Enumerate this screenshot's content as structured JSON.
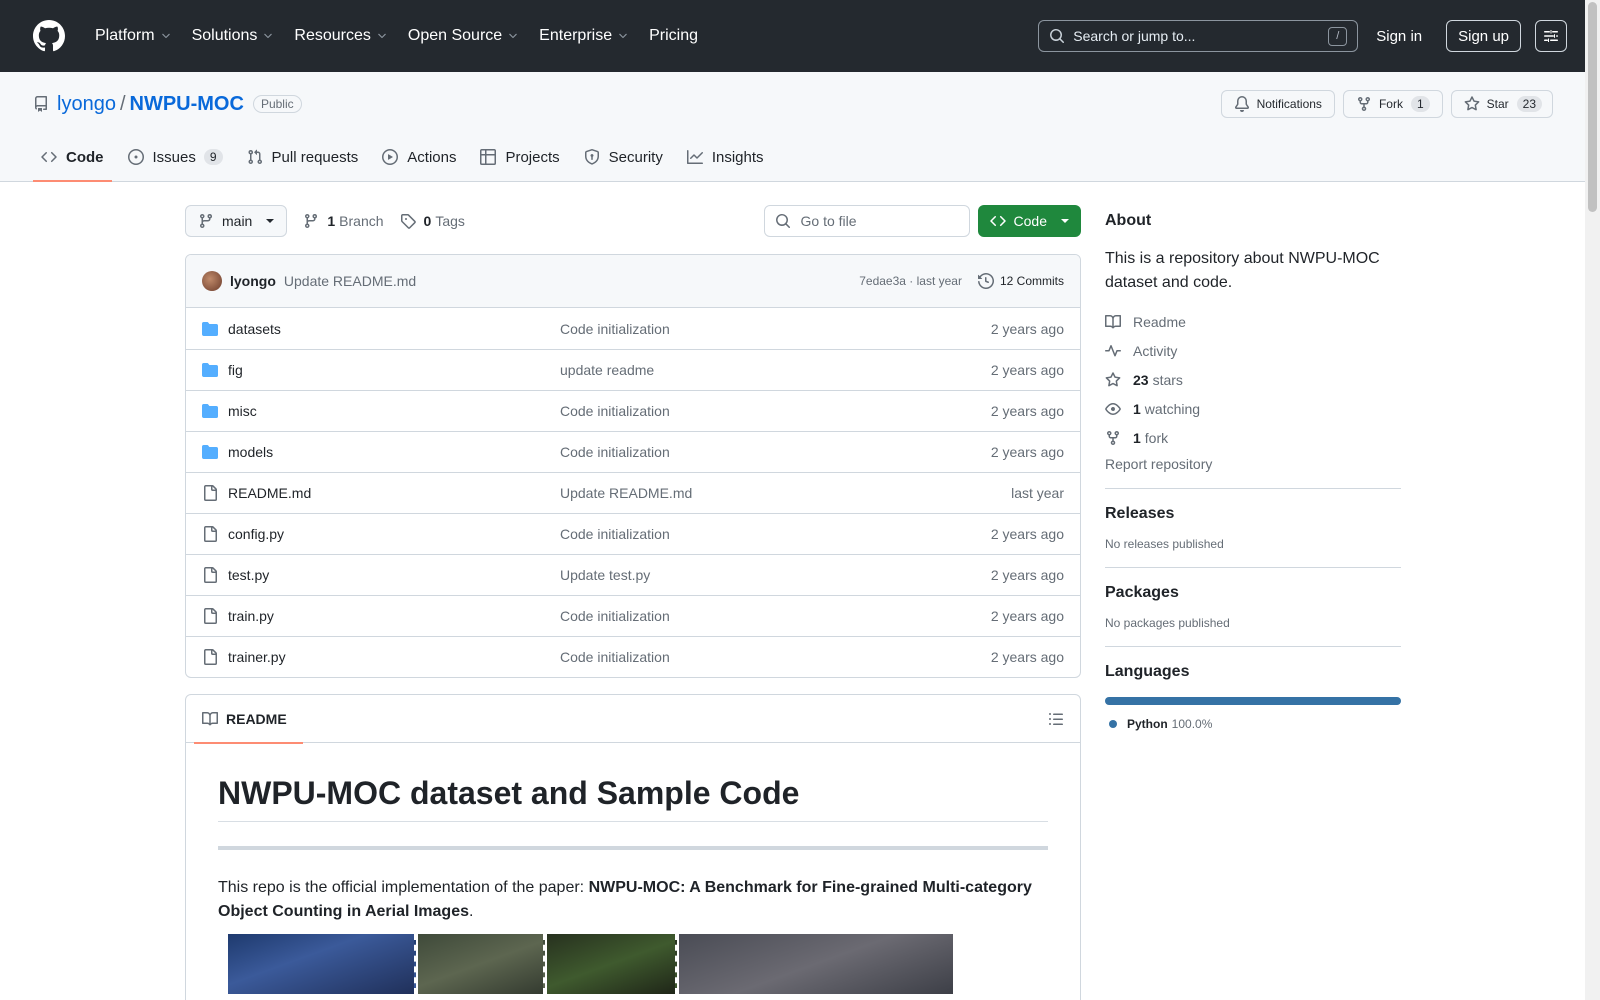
{
  "header": {
    "nav": [
      "Platform",
      "Solutions",
      "Resources",
      "Open Source",
      "Enterprise",
      "Pricing"
    ],
    "search_placeholder": "Search or jump to...",
    "search_shortcut": "/",
    "signin": "Sign in",
    "signup": "Sign up"
  },
  "repo": {
    "owner": "lyongo",
    "sep": "/",
    "name": "NWPU-MOC",
    "visibility": "Public",
    "notifications_label": "Notifications",
    "fork_label": "Fork",
    "fork_count": "1",
    "star_label": "Star",
    "star_count": "23"
  },
  "tabs": [
    {
      "label": "Code",
      "icon": "code-icon",
      "active": true
    },
    {
      "label": "Issues",
      "icon": "issue-icon",
      "count": "9"
    },
    {
      "label": "Pull requests",
      "icon": "pull-request-icon"
    },
    {
      "label": "Actions",
      "icon": "play-icon"
    },
    {
      "label": "Projects",
      "icon": "table-icon"
    },
    {
      "label": "Security",
      "icon": "shield-icon"
    },
    {
      "label": "Insights",
      "icon": "graph-icon"
    }
  ],
  "toolbar": {
    "branch": "main",
    "branch_count": "1",
    "branch_label": "Branch",
    "tag_count": "0",
    "tag_label": "Tags",
    "goto_placeholder": "Go to file",
    "code_label": "Code"
  },
  "latest_commit": {
    "author": "lyongo",
    "message": "Update README.md",
    "hash": "7edae3a",
    "time": "last year",
    "commits_label": "12 Commits"
  },
  "files": [
    {
      "name": "datasets",
      "type": "dir",
      "commit": "Code initialization",
      "age": "2 years ago"
    },
    {
      "name": "fig",
      "type": "dir",
      "commit": "update readme",
      "age": "2 years ago"
    },
    {
      "name": "misc",
      "type": "dir",
      "commit": "Code initialization",
      "age": "2 years ago"
    },
    {
      "name": "models",
      "type": "dir",
      "commit": "Code initialization",
      "age": "2 years ago"
    },
    {
      "name": "README.md",
      "type": "file",
      "commit": "Update README.md",
      "age": "last year"
    },
    {
      "name": "config.py",
      "type": "file",
      "commit": "Code initialization",
      "age": "2 years ago"
    },
    {
      "name": "test.py",
      "type": "file",
      "commit": "Update test.py",
      "age": "2 years ago"
    },
    {
      "name": "train.py",
      "type": "file",
      "commit": "Code initialization",
      "age": "2 years ago"
    },
    {
      "name": "trainer.py",
      "type": "file",
      "commit": "Code initialization",
      "age": "2 years ago"
    }
  ],
  "readme": {
    "tab_label": "README",
    "title": "NWPU-MOC dataset and Sample Code",
    "intro": "This repo is the official implementation of the paper: ",
    "paper_title": "NWPU-MOC: A Benchmark for Fine-grained Multi-category Object Counting in Aerial Images",
    "intro_end": "."
  },
  "about": {
    "title": "About",
    "description": "This is a repository about NWPU-MOC dataset and code.",
    "readme": "Readme",
    "activity": "Activity",
    "stars_count": "23",
    "stars_label": "stars",
    "watching_count": "1",
    "watching_label": "watching",
    "forks_count": "1",
    "forks_label": "fork",
    "report": "Report repository"
  },
  "releases": {
    "title": "Releases",
    "empty": "No releases published"
  },
  "packages": {
    "title": "Packages",
    "empty": "No packages published"
  },
  "languages": {
    "title": "Languages",
    "items": [
      {
        "name": "Python",
        "pct": "100.0%",
        "color": "#3572A5"
      }
    ]
  }
}
